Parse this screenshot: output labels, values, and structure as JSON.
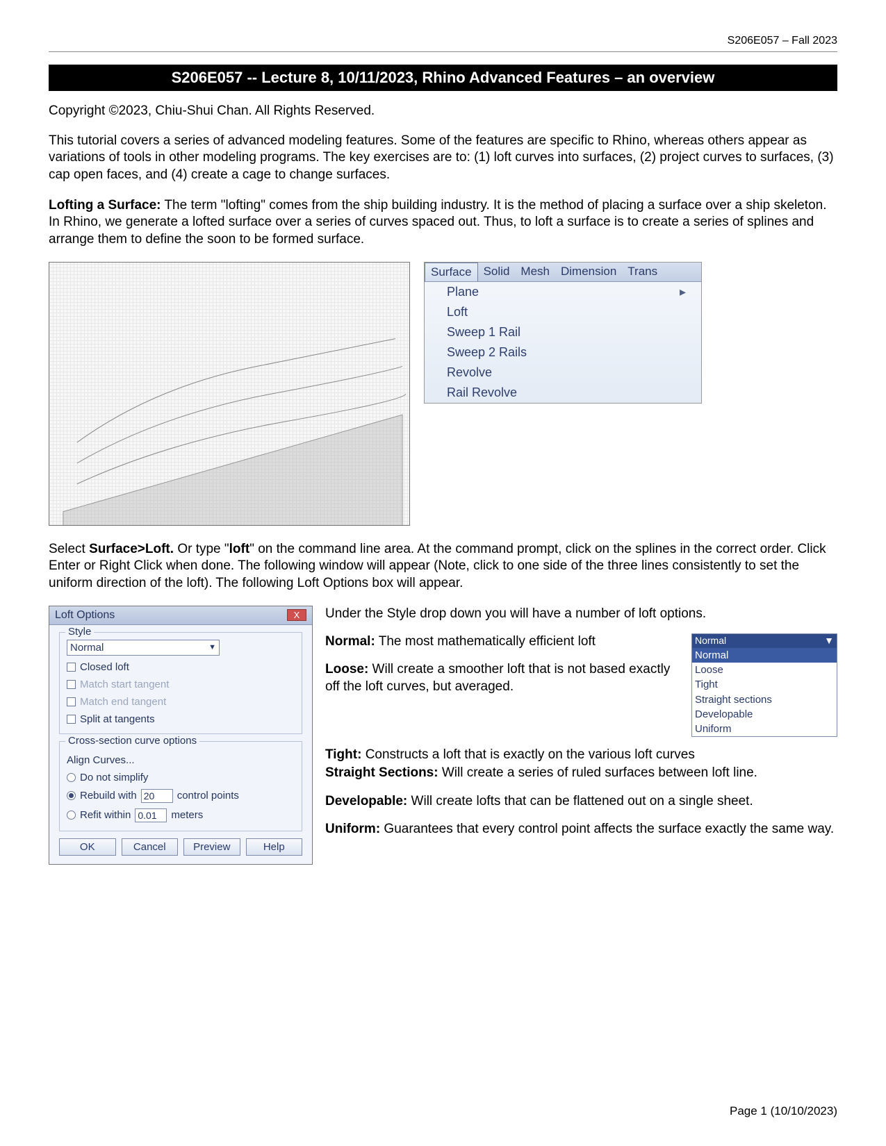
{
  "header": {
    "course_id": "S206E057 – Fall 2023"
  },
  "title": "S206E057 -- Lecture 8, 10/11/2023, Rhino Advanced Features – an overview",
  "copyright": "Copyright ©2023, Chiu-Shui  Chan. All Rights Reserved.",
  "intro": "This tutorial covers a series of advanced modeling features.  Some of the features are specific to Rhino, whereas others appear as variations of tools in other modeling programs. The key exercises are to: (1) loft curves into surfaces, (2) project curves to surfaces, (3) cap open faces, and (4) create a cage to change surfaces.",
  "lofting_heading": "Lofting a Surface:",
  "lofting_body": "  The term \"lofting\" comes from the ship building industry.  It is the method of placing a surface over a ship skeleton.  In Rhino, we generate a lofted surface over a series of curves spaced out.  Thus, to loft a surface is to create a series of splines and arrange them to define the soon to be formed surface.",
  "menu": {
    "tabs": [
      "Surface",
      "Solid",
      "Mesh",
      "Dimension",
      "Trans"
    ],
    "active_tab": "Surface",
    "items": [
      "Plane",
      "Loft",
      "Sweep 1 Rail",
      "Sweep 2 Rails",
      "Revolve",
      "Rail Revolve"
    ]
  },
  "select_text_pre": "Select ",
  "select_bold1": "Surface>Loft.",
  "select_text_mid": "  Or type \"",
  "select_bold2": "loft",
  "select_text_post": "\" on the command line area. At the command prompt, click on the splines in the correct order.  Click Enter or Right Click when done.  The following window will appear (Note, click to one side of the three lines consistently to set the uniform direction of the loft). The following Loft Options box will appear.",
  "dialog": {
    "title": "Loft Options",
    "close": "X",
    "style_label": "Style",
    "style_value": "Normal",
    "checks": {
      "closed": "Closed loft",
      "match_start": "Match start tangent",
      "match_end": "Match end tangent",
      "split": "Split at tangents"
    },
    "cross_label": "Cross-section curve options",
    "align": "Align Curves...",
    "simplify": "Do not simplify",
    "rebuild": "Rebuild with",
    "rebuild_val": "20",
    "rebuild_unit": "control points",
    "refit": "Refit within",
    "refit_val": "0.01",
    "refit_unit": "meters",
    "buttons": {
      "ok": "OK",
      "cancel": "Cancel",
      "preview": "Preview",
      "help": "Help"
    }
  },
  "under_style": "Under the Style drop down you will have a number of loft options.",
  "desc": {
    "normal_h": "Normal:",
    "normal_t": " The most mathematically efficient loft",
    "loose_h": "Loose:",
    "loose_t": " Will create a smoother loft that is not based exactly off the loft curves, but averaged.",
    "tight_h": "Tight:",
    "tight_t": " Constructs a loft that is exactly on the various loft curves",
    "ss_h": "Straight Sections:",
    "ss_t": " Will create a series of ruled surfaces between loft line.",
    "dev_h": "Developable:",
    "dev_t": " Will create lofts that can be flattened out on a single sheet.",
    "uni_h": "Uniform:",
    "uni_t": " Guarantees that every control point affects the surface exactly the same way."
  },
  "style_list": {
    "header": "Normal",
    "options": [
      "Normal",
      "Loose",
      "Tight",
      "Straight sections",
      "Developable",
      "Uniform"
    ]
  },
  "footer": "Page 1 (10/10/2023)"
}
